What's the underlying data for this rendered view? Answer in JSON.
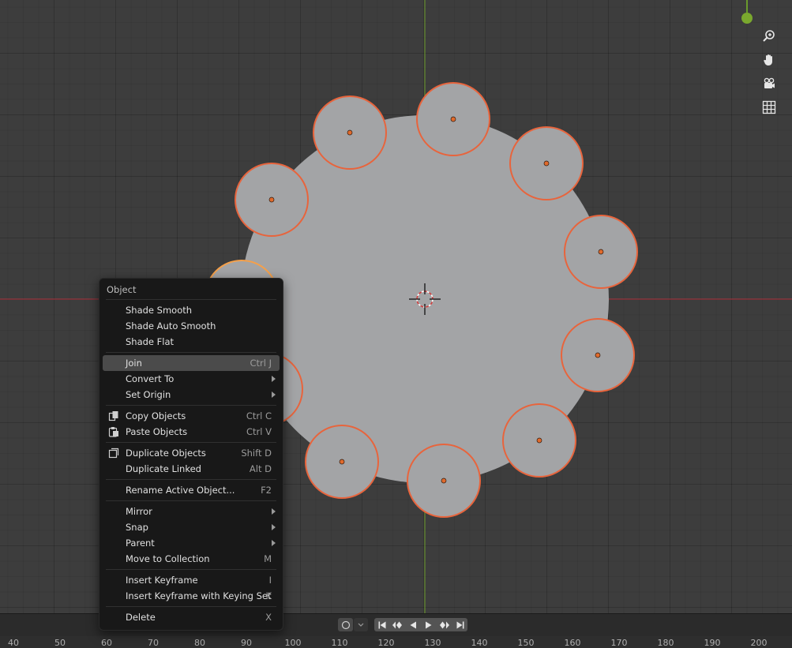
{
  "menu": {
    "title": "Object",
    "items": [
      {
        "label": "Shade Smooth",
        "shortcut": "",
        "submenu": false,
        "icon": ""
      },
      {
        "label": "Shade Auto Smooth",
        "shortcut": "",
        "submenu": false,
        "icon": ""
      },
      {
        "label": "Shade Flat",
        "shortcut": "",
        "submenu": false,
        "icon": ""
      },
      {
        "label": "Join",
        "shortcut": "Ctrl J",
        "submenu": false,
        "icon": "",
        "active": true
      },
      {
        "label": "Convert To",
        "shortcut": "",
        "submenu": true,
        "icon": ""
      },
      {
        "label": "Set Origin",
        "shortcut": "",
        "submenu": true,
        "icon": ""
      },
      {
        "label": "Copy Objects",
        "shortcut": "Ctrl C",
        "submenu": false,
        "icon": "copy-icon"
      },
      {
        "label": "Paste Objects",
        "shortcut": "Ctrl V",
        "submenu": false,
        "icon": "paste-icon"
      },
      {
        "label": "Duplicate Objects",
        "shortcut": "Shift D",
        "submenu": false,
        "icon": "duplicate-icon"
      },
      {
        "label": "Duplicate Linked",
        "shortcut": "Alt D",
        "submenu": false,
        "icon": ""
      },
      {
        "label": "Rename Active Object...",
        "shortcut": "F2",
        "submenu": false,
        "icon": ""
      },
      {
        "label": "Mirror",
        "shortcut": "",
        "submenu": true,
        "icon": ""
      },
      {
        "label": "Snap",
        "shortcut": "",
        "submenu": true,
        "icon": ""
      },
      {
        "label": "Parent",
        "shortcut": "",
        "submenu": true,
        "icon": ""
      },
      {
        "label": "Move to Collection",
        "shortcut": "M",
        "submenu": false,
        "icon": ""
      },
      {
        "label": "Insert Keyframe",
        "shortcut": "I",
        "submenu": false,
        "icon": ""
      },
      {
        "label": "Insert Keyframe with Keying Set",
        "shortcut": "K",
        "submenu": false,
        "icon": ""
      },
      {
        "label": "Delete",
        "shortcut": "X",
        "submenu": false,
        "icon": ""
      }
    ]
  },
  "viewport_tools": [
    {
      "name": "zoom-icon"
    },
    {
      "name": "pan-hand-icon"
    },
    {
      "name": "camera-view-icon"
    },
    {
      "name": "ortho-grid-icon"
    }
  ],
  "timeline": {
    "ruler_labels": [
      "40",
      "50",
      "60",
      "70",
      "80",
      "90",
      "100",
      "110",
      "120",
      "130",
      "140",
      "150",
      "160",
      "170",
      "180",
      "190",
      "200"
    ],
    "playback_buttons": [
      "jump-start-icon",
      "prev-keyframe-icon",
      "play-reverse-icon",
      "play-icon",
      "next-keyframe-icon",
      "jump-end-icon"
    ]
  },
  "colors": {
    "selection_outline": "#e8643c",
    "active_outline": "#f5a04a",
    "mesh": "#a3a4a6",
    "x_axis": "#b3343f",
    "y_axis": "#6a9a2c"
  }
}
